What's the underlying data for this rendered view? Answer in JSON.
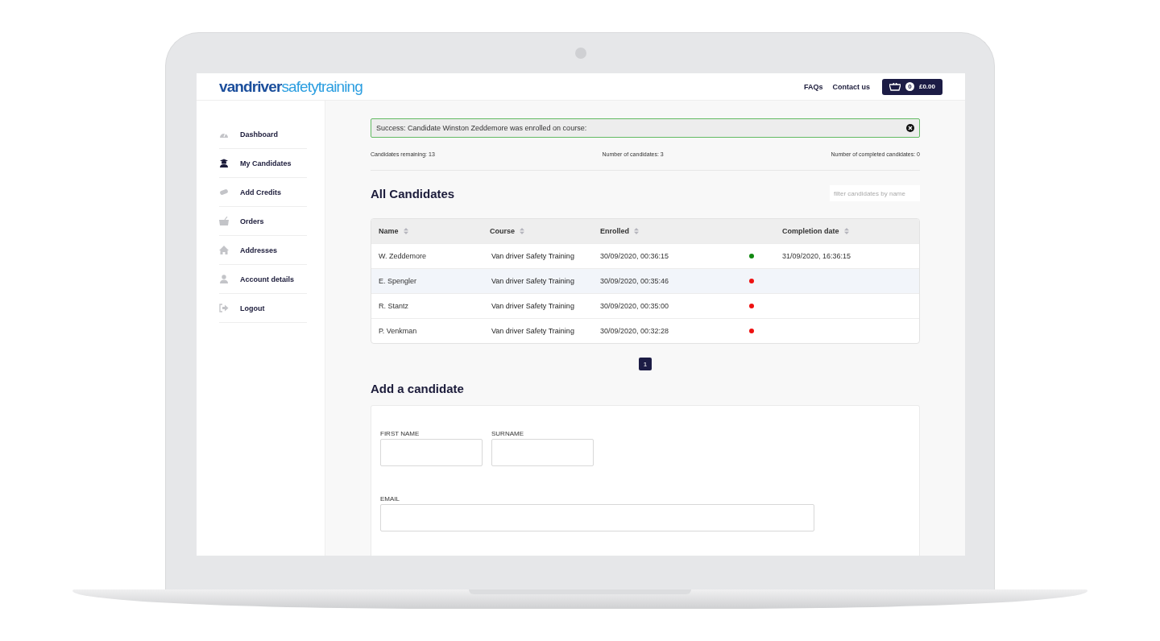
{
  "header": {
    "logo": {
      "first": "vandriver",
      "second": "safetytraining"
    },
    "links": [
      "FAQs",
      "Contact us"
    ],
    "cart": {
      "count": "0",
      "total": "£0.00"
    }
  },
  "sidebar": {
    "items": [
      {
        "label": "Dashboard",
        "selected": false
      },
      {
        "label": "My Candidates",
        "selected": true
      },
      {
        "label": "Add Credits",
        "selected": false
      },
      {
        "label": "Orders",
        "selected": false
      },
      {
        "label": "Addresses",
        "selected": false
      },
      {
        "label": "Account details",
        "selected": false
      },
      {
        "label": "Logout",
        "selected": false
      }
    ]
  },
  "alert": {
    "message": "Success: Candidate Winston Zeddemore was enrolled on course:"
  },
  "stats": [
    "Candidates remaining: 13",
    "Number of candidates: 3",
    "Number of completed candidates: 0"
  ],
  "candidates": {
    "title": "All Candidates",
    "filter": {
      "placeholder": "filter candidates by name"
    },
    "columns": [
      "Name",
      "Course",
      "Enrolled",
      "Completion date"
    ],
    "rows": [
      {
        "name": "W. Zeddemore",
        "course": "Van driver Safety Training",
        "enrolled": "30/09/2020, 00:36:15",
        "color": "#118811",
        "completed": "31/09/2020, 16:36:15",
        "selected": false
      },
      {
        "name": "E. Spengler",
        "course": "Van driver Safety Training",
        "enrolled": "30/09/2020, 00:35:46",
        "color": "#ee1111",
        "selected": true
      },
      {
        "name": "R. Stantz",
        "course": "Van driver Safety Training",
        "enrolled": "30/09/2020, 00:35:00",
        "color": "#ee1111",
        "selected": false
      },
      {
        "name": "P. Venkman",
        "course": "Van driver Safety Training",
        "enrolled": "30/09/2020, 00:32:28",
        "color": "#ee1111",
        "selected": false
      }
    ],
    "pages": [
      {
        "label": "1",
        "selected": true
      }
    ]
  },
  "add_candidate": {
    "title": "Add a candidate",
    "fields": [
      {
        "label": "FIRST NAME",
        "kind": "short"
      },
      {
        "label": "SURNAME",
        "kind": "short"
      },
      {
        "label": "EMAIL",
        "kind": "wide"
      }
    ]
  }
}
